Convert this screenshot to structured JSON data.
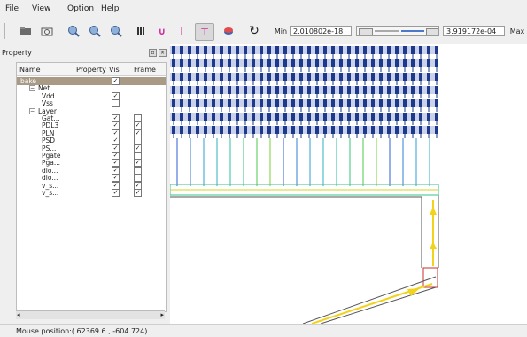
{
  "menu": {
    "file": "File",
    "view": "View",
    "option": "Option",
    "help": "Help"
  },
  "toolbar": {
    "min_label": "Min",
    "min_value": "2.010802e-18",
    "max_value": "3.919172e-04",
    "max_label": "Max"
  },
  "panel": {
    "title": "Property",
    "columns": [
      "Name",
      "Property",
      "Vis",
      "Frame"
    ]
  },
  "tree": [
    {
      "name": "bake",
      "depth": 0,
      "vis": true,
      "frame": null,
      "selected": true
    },
    {
      "name": "Net",
      "depth": 1,
      "vis": null,
      "frame": null,
      "expand": true
    },
    {
      "name": "Vdd",
      "depth": 2,
      "vis": true,
      "frame": null
    },
    {
      "name": "Vss",
      "depth": 2,
      "vis": false,
      "frame": null
    },
    {
      "name": "Layer",
      "depth": 1,
      "vis": null,
      "frame": null,
      "expand": true
    },
    {
      "name": "Gat...",
      "depth": 2,
      "vis": true,
      "frame": false
    },
    {
      "name": "PDL3",
      "depth": 2,
      "vis": true,
      "frame": true
    },
    {
      "name": "PLN",
      "depth": 2,
      "vis": true,
      "frame": true
    },
    {
      "name": "PSD",
      "depth": 2,
      "vis": true,
      "frame": false
    },
    {
      "name": "PS...",
      "depth": 2,
      "vis": true,
      "frame": true
    },
    {
      "name": "Pgate",
      "depth": 2,
      "vis": true,
      "frame": false
    },
    {
      "name": "Pga...",
      "depth": 2,
      "vis": true,
      "frame": true
    },
    {
      "name": "dio...",
      "depth": 2,
      "vis": true,
      "frame": false
    },
    {
      "name": "dio...",
      "depth": 2,
      "vis": true,
      "frame": false
    },
    {
      "name": "v_s...",
      "depth": 2,
      "vis": true,
      "frame": true
    },
    {
      "name": "v_s...",
      "depth": 2,
      "vis": true,
      "frame": true
    }
  ],
  "status": {
    "mouse_position": "Mouse position:( 62369.6 , -604.724)"
  },
  "colors": {
    "cell_blue": "#1d3a8a",
    "selection": "#a89a85",
    "accent_yellow": "#f2d21b"
  }
}
